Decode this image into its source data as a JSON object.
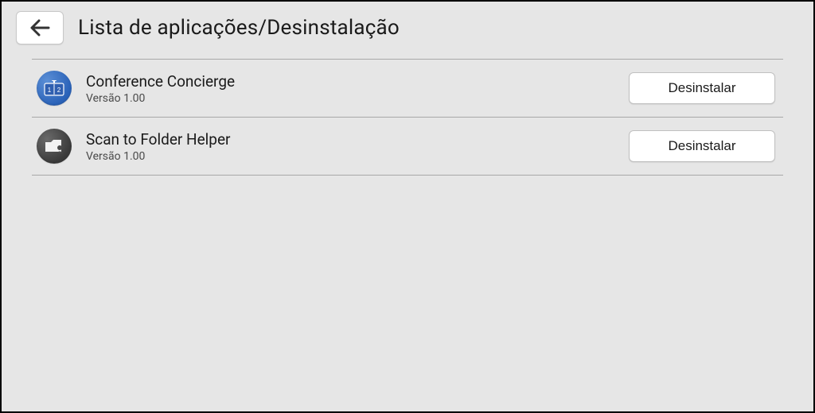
{
  "header": {
    "title": "Lista de aplicações/Desinstalação"
  },
  "buttons": {
    "uninstall": "Desinstalar"
  },
  "version_label": "Versão",
  "apps": [
    {
      "name": "Conference Concierge",
      "version": "1.00",
      "icon": "conference"
    },
    {
      "name": "Scan to Folder Helper",
      "version": "1.00",
      "icon": "scan"
    }
  ]
}
